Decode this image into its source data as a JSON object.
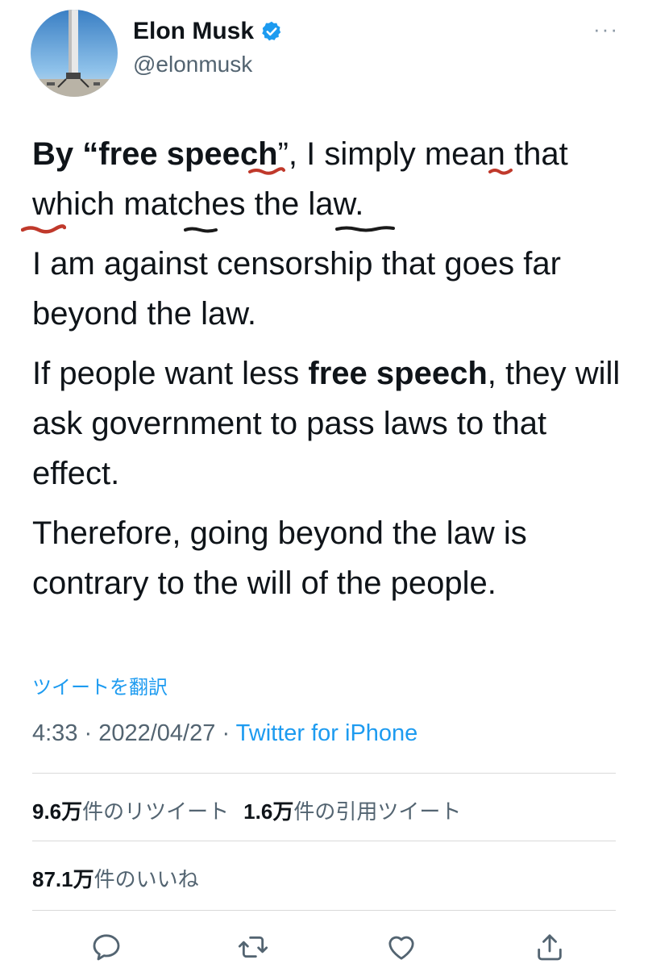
{
  "header": {
    "name": "Elon Musk",
    "handle": "@elonmusk",
    "more": "···"
  },
  "tweet": {
    "p1_bold_start": "By “free speech",
    "p1_rest": "”, I simply mean that which matches the law.",
    "p2": "I am against censorship that goes far beyond the law.",
    "p3_start": "If people want less ",
    "p3_bold": "free speech",
    "p3_end": ", they will ask government to pass laws to that effect.",
    "p4": "Therefore, going beyond the law is contrary to the will of the people."
  },
  "translate_link": "ツイートを翻訳",
  "meta": {
    "time": "4:33",
    "sep1": " · ",
    "date": "2022/04/27",
    "sep2": " · ",
    "source": "Twitter for iPhone"
  },
  "stats": {
    "retweets_count": "9.6万",
    "retweets_label": "件のリツイート",
    "quotes_count": "1.6万",
    "quotes_label": "件の引用ツイート",
    "likes_count": "87.1万",
    "likes_label": "件のいいね"
  },
  "actions": [
    "reply-icon",
    "retweet-icon",
    "like-icon",
    "share-icon"
  ],
  "colors": {
    "accent": "#1d9bf0",
    "text": "#0f1419",
    "secondary": "#536471",
    "annotation_red": "#c0392b",
    "annotation_black": "#1a1a1a"
  }
}
